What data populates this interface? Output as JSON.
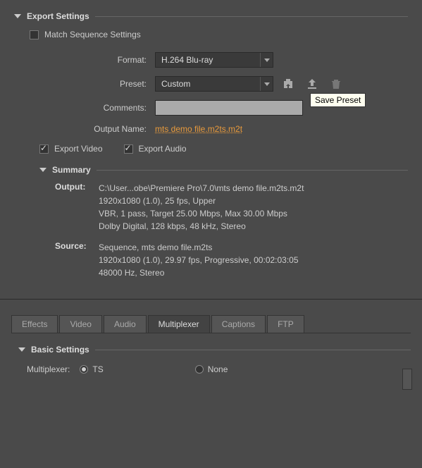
{
  "export_settings": {
    "title": "Export Settings",
    "match_sequence_label": "Match Sequence Settings",
    "fields": {
      "format_label": "Format:",
      "format_value": "H.264 Blu-ray",
      "preset_label": "Preset:",
      "preset_value": "Custom",
      "comments_label": "Comments:",
      "comments_value": "",
      "output_name_label": "Output Name:",
      "output_name_value": "mts demo file.m2ts.m2t"
    },
    "save_preset_tooltip": "Save Preset",
    "export_video_label": "Export Video",
    "export_audio_label": "Export Audio"
  },
  "summary": {
    "title": "Summary",
    "output_label": "Output:",
    "output_lines": [
      "C:\\User...obe\\Premiere Pro\\7.0\\mts demo file.m2ts.m2t",
      "1920x1080 (1.0), 25 fps, Upper",
      "VBR, 1 pass, Target 25.00 Mbps, Max 30.00 Mbps",
      "Dolby Digital, 128 kbps, 48 kHz, Stereo"
    ],
    "source_label": "Source:",
    "source_lines": [
      "Sequence, mts demo file.m2ts",
      "1920x1080 (1.0), 29.97 fps, Progressive, 00:02:03:05",
      "48000 Hz, Stereo"
    ]
  },
  "tabs": {
    "effects": "Effects",
    "video": "Video",
    "audio": "Audio",
    "multiplexer": "Multiplexer",
    "captions": "Captions",
    "ftp": "FTP"
  },
  "basic_settings": {
    "title": "Basic Settings",
    "multiplexer_label": "Multiplexer:",
    "option_ts": "TS",
    "option_none": "None"
  }
}
